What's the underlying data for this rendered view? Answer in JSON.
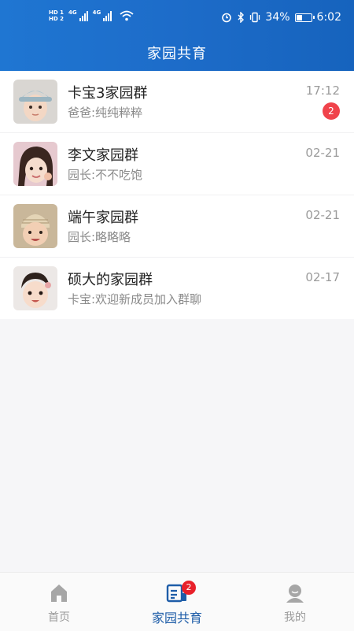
{
  "status_bar": {
    "hd_top": "HD 1",
    "hd_bottom": "HD 2",
    "net1": "4G",
    "net2": "4G",
    "battery_percent": "34%",
    "time": "6:02"
  },
  "header": {
    "title": "家园共育"
  },
  "conversations": [
    {
      "name": "卡宝3家园群",
      "last_message": "爸爸:纯纯粹粹",
      "time": "17:12",
      "unread": "2"
    },
    {
      "name": "李文家园群",
      "last_message": "园长:不不吃饱",
      "time": "02-21"
    },
    {
      "name": "端午家园群",
      "last_message": "园长:略略略",
      "time": "02-21"
    },
    {
      "name": "硕大的家园群",
      "last_message": "卡宝:欢迎新成员加入群聊",
      "time": "02-17"
    }
  ],
  "tabbar": {
    "tabs": [
      {
        "label": "首页",
        "icon": "home-icon"
      },
      {
        "label": "家园共育",
        "icon": "chat-list-icon",
        "badge": "2"
      },
      {
        "label": "我的",
        "icon": "profile-icon"
      }
    ],
    "active_color": "#1e5da8"
  },
  "colors": {
    "header_blue": "#1d6cc9",
    "badge_red": "#f0434b"
  }
}
